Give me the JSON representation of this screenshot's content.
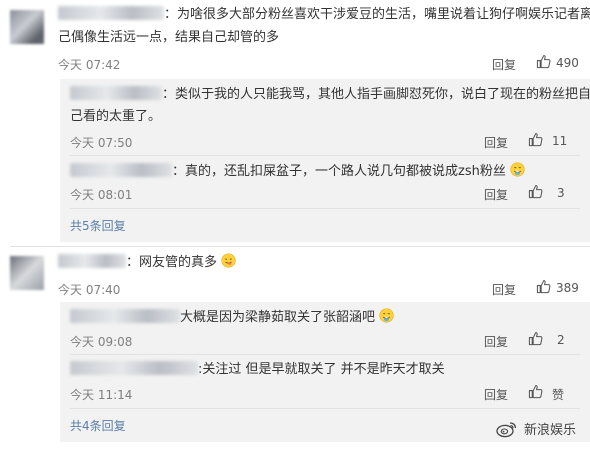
{
  "comments": [
    {
      "text": "：为啥很多大部分粉丝喜欢干涉爱豆的生活，嘴里说着让狗仔啊娱乐记者离自",
      "text2": "己偶像生活远一点，结果自己却管的多",
      "time": "今天 07:42",
      "reply_label": "回复",
      "likes": "490",
      "replies": [
        {
          "text": "：类似于我的人只能我骂，其他人指手画脚怼死你，说白了现在的粉丝把自",
          "text2": "己看的太重了。",
          "time": "今天 07:50",
          "reply_label": "回复",
          "likes": "11"
        },
        {
          "text": "：真的，还乱扣屎盆子，一个路人说几句都被说成zsh粉丝",
          "time": "今天 08:01",
          "reply_label": "回复",
          "likes": "3"
        }
      ],
      "more": "共5条回复"
    },
    {
      "text": "：网友管的真多",
      "time": "今天 07:40",
      "reply_label": "回复",
      "likes": "389",
      "replies": [
        {
          "text": "大概是因为梁静茹取关了张韶涵吧",
          "time": "今天 09:08",
          "reply_label": "回复",
          "likes": "2"
        },
        {
          "text": ":关注过 但是早就取关了 并不是昨天才取关",
          "time": "今天 11:14",
          "reply_label": "回复",
          "likes": "赞"
        }
      ],
      "more": "共4条回复"
    }
  ],
  "watermark": "新浪娱乐",
  "icons": [
    "thumb-up-icon",
    "emoji-icon",
    "weibo-logo"
  ],
  "colors": {
    "link": "#5a7ea8",
    "reply_bg": "#f2f2f2",
    "meta": "#808080"
  }
}
